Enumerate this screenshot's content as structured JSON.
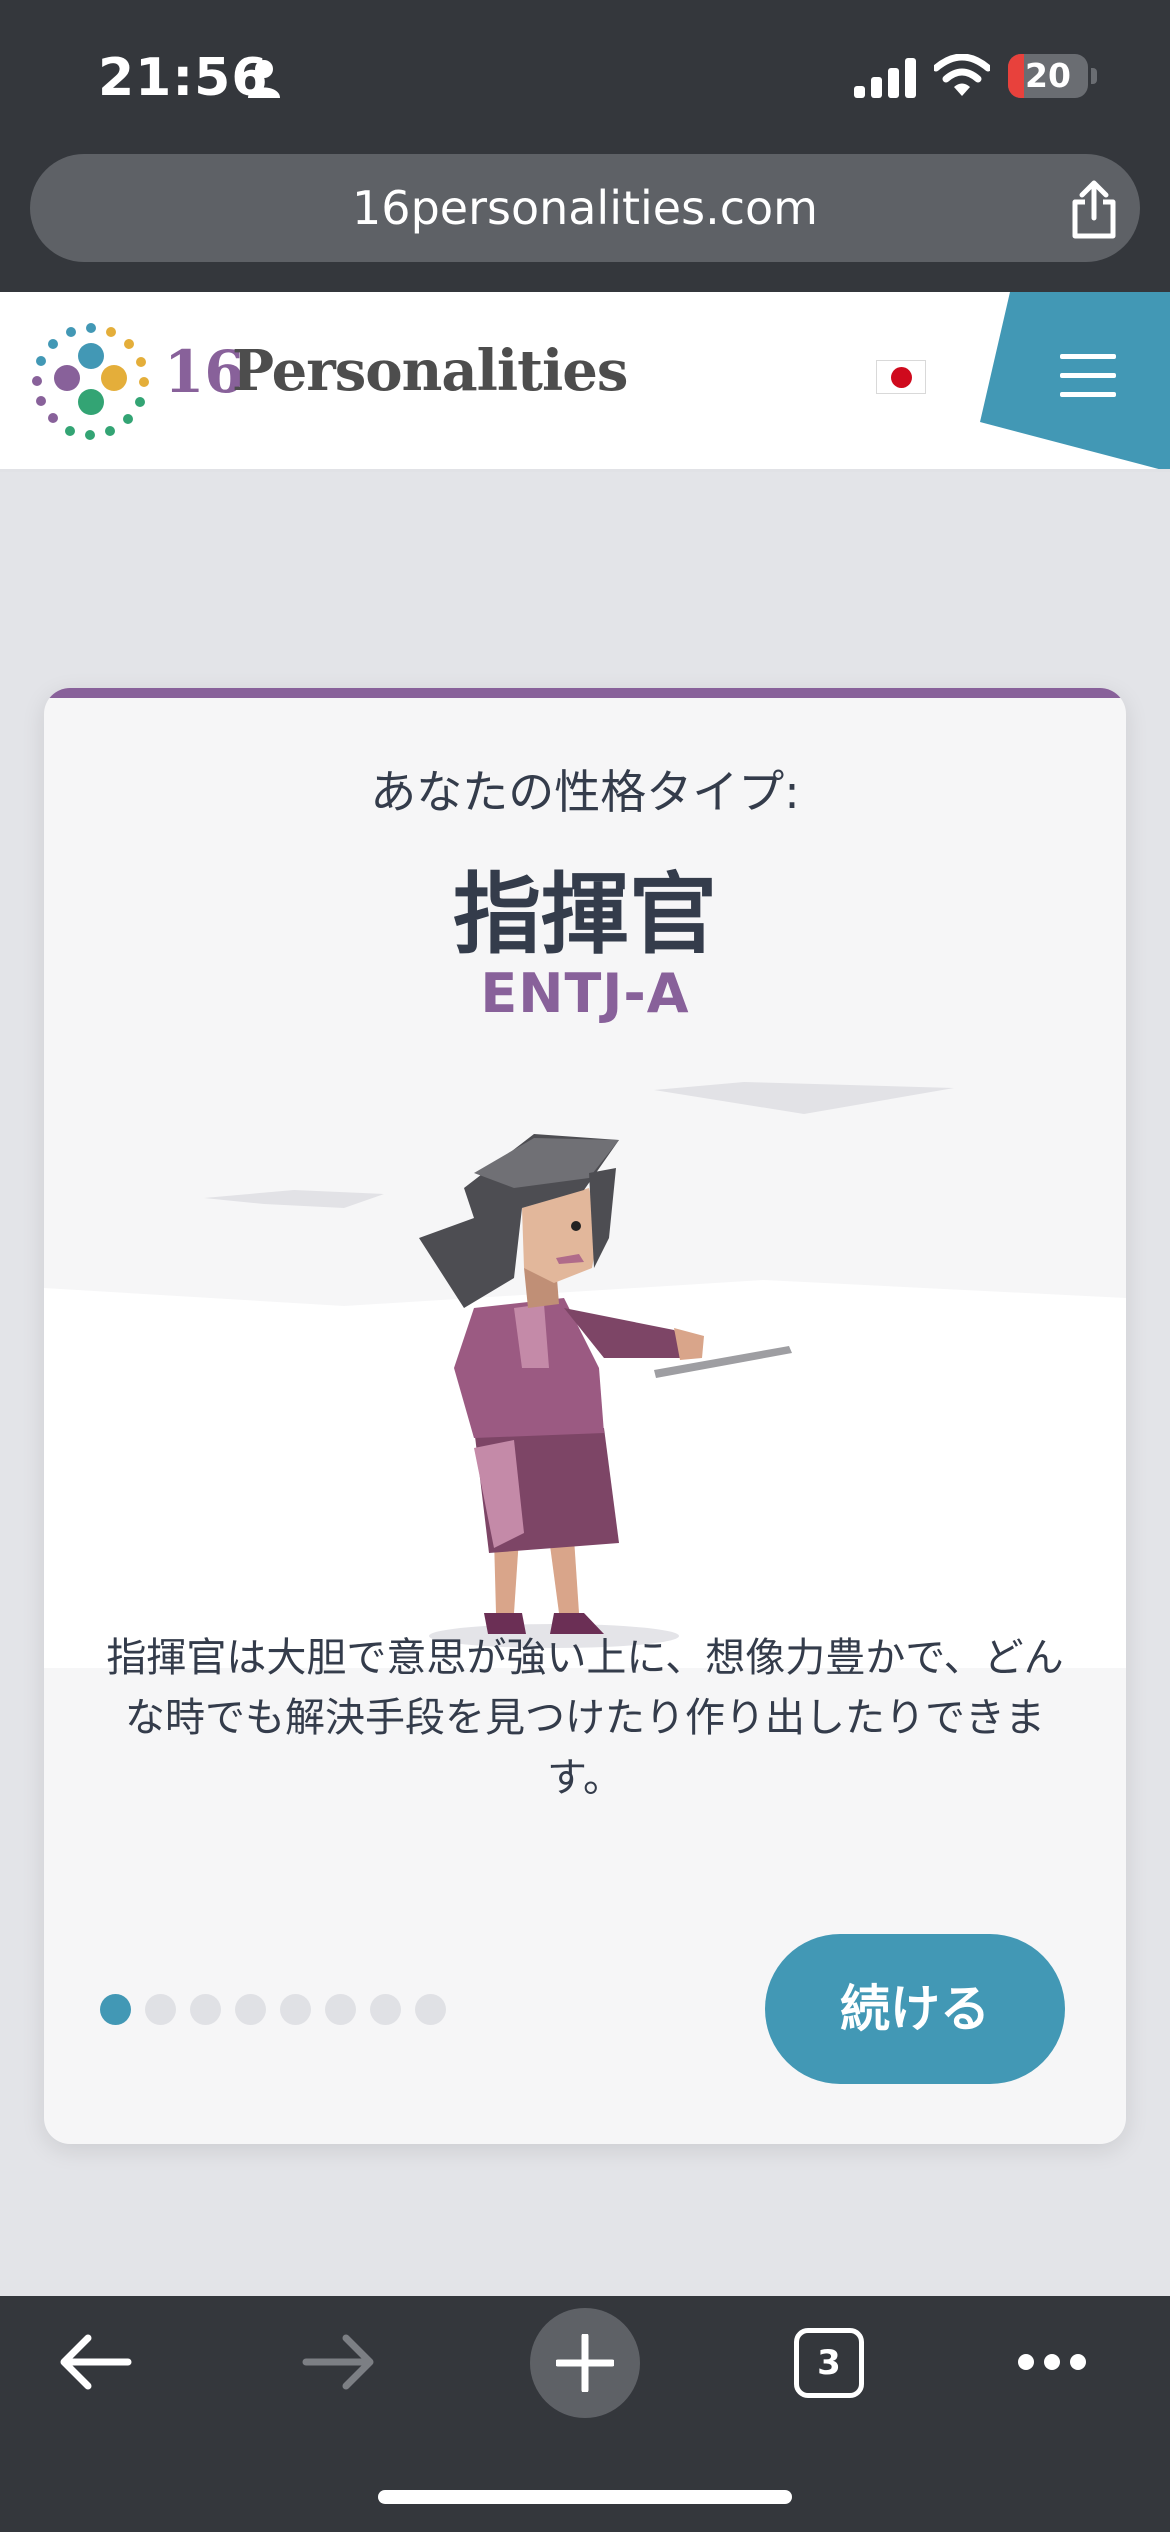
{
  "status_bar": {
    "time": "21:56",
    "battery_level": "20",
    "battery_fraction": 0.2,
    "icons": [
      "person-icon",
      "signal-icon",
      "wifi-icon",
      "battery-icon"
    ]
  },
  "browser": {
    "url": "16personalities.com",
    "share_icon": "share-icon",
    "tab_count": "3",
    "toolbar_icons": [
      "back-icon",
      "forward-icon",
      "plus-icon",
      "tabs-icon",
      "more-icon"
    ]
  },
  "site_header": {
    "logo_number": "16",
    "logo_word": "Personalities",
    "language_flag": "japan-flag-icon",
    "menu_icon": "hamburger-menu-icon"
  },
  "result_card": {
    "label": "あなたの性格タイプ:",
    "type_name": "指揮官",
    "type_code": "ENTJ-A",
    "description": "指揮官は大胆で意思が強い上に、想像力豊かで、どんな時でも解決手段を見つけたり作り出したりできます。",
    "continue_label": "続ける",
    "pagination": {
      "total": 8,
      "current": 1
    }
  },
  "colors": {
    "dark_chrome": "#34373c",
    "accent_purple": "#88619a",
    "accent_blue": "#4298b5",
    "text_dark": "#343c4b",
    "flag_red": "#cf0a1d"
  }
}
